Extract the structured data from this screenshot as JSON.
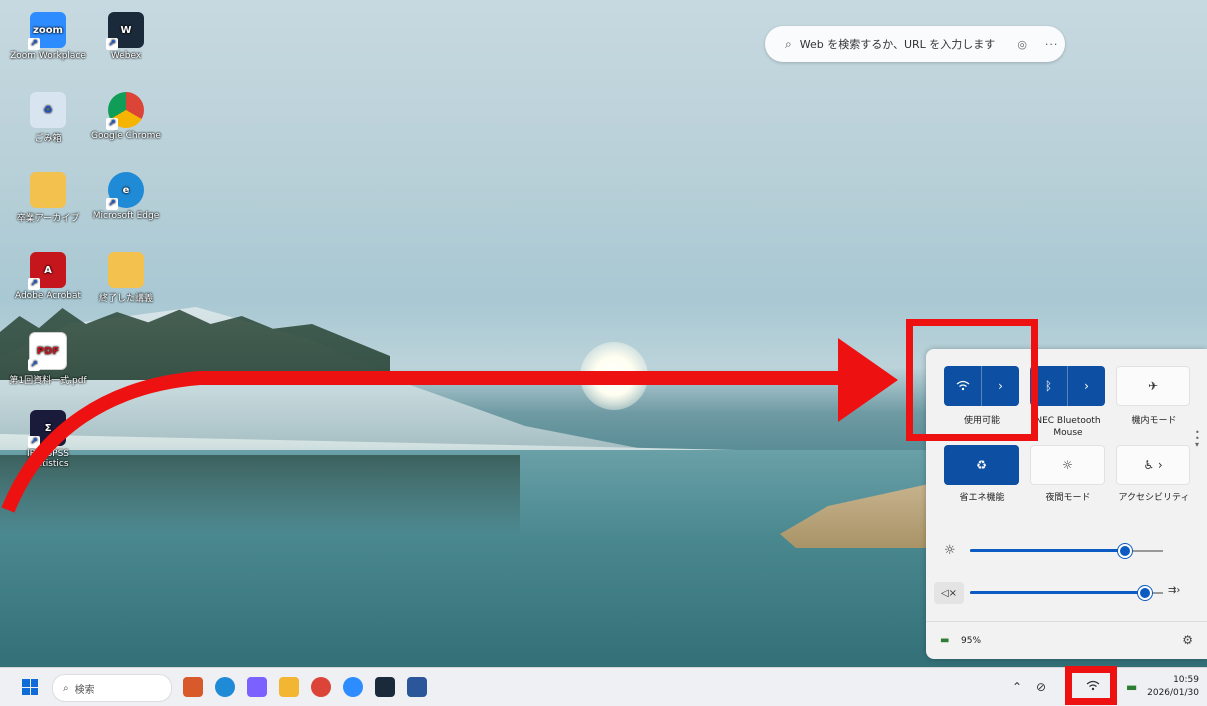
{
  "browser_search": {
    "placeholder": "Web を検索するか、URL を入力します",
    "search_icon": "search-icon",
    "visual_search_icon": "visual-search-icon",
    "more_label": "···"
  },
  "desktop_icons": [
    {
      "label": "Zoom Workplace",
      "icon": "zoom-icon",
      "text": "zoom",
      "color": "#2d8cff"
    },
    {
      "label": "Webex",
      "icon": "webex-icon",
      "text": "W",
      "color": "#1b2a3a"
    },
    {
      "label": "ごみ箱",
      "icon": "recycle-bin-icon",
      "text": "♻",
      "color": "#d8e4f0"
    },
    {
      "label": "Google Chrome",
      "icon": "chrome-icon",
      "text": "",
      "color": "#db4437"
    },
    {
      "label": "卒業アーカイブ",
      "icon": "folder-icon",
      "text": "",
      "color": "#f2c14e"
    },
    {
      "label": "Microsoft Edge",
      "icon": "edge-icon",
      "text": "e",
      "color": "#1f8ad6"
    },
    {
      "label": "Adobe Acrobat",
      "icon": "acrobat-icon",
      "text": "A",
      "color": "#c4161c"
    },
    {
      "label": "終了した講義",
      "icon": "folder-icon",
      "text": "",
      "color": "#f2c14e"
    },
    {
      "label": "第1回資料一式.pdf",
      "icon": "pdf-icon",
      "text": "PDF",
      "color": "#ffffff"
    },
    {
      "label": "IBM SPSS Statistics",
      "icon": "spss-icon",
      "text": "Σ",
      "color": "#1a1a3a"
    }
  ],
  "quick_settings": {
    "tiles": [
      {
        "label": "使用可能",
        "icon": "wifi-icon",
        "state": "on",
        "has_arrow": true
      },
      {
        "label": "NEC Bluetooth Mouse",
        "icon": "bluetooth-icon",
        "state": "on",
        "has_arrow": true
      },
      {
        "label": "機内モード",
        "icon": "airplane-icon",
        "state": "off",
        "has_arrow": false
      },
      {
        "label": "省エネ機能",
        "icon": "energy-saver-icon",
        "state": "on",
        "has_arrow": false
      },
      {
        "label": "夜間モード",
        "icon": "night-light-icon",
        "state": "off",
        "has_arrow": false
      },
      {
        "label": "アクセシビリティ",
        "icon": "accessibility-icon",
        "state": "off",
        "has_arrow": true
      }
    ],
    "brightness": {
      "icon": "brightness-icon",
      "level": 0.8
    },
    "volume": {
      "icon": "speaker-muted-icon",
      "level": 0.9,
      "output_icon": "audio-output-icon"
    },
    "battery_label": "95%",
    "settings_icon": "gear-icon"
  },
  "taskbar": {
    "search_placeholder": "検索",
    "apps": [
      {
        "name": "news-widget",
        "icon": "widget-icon",
        "color": "#d85a2a"
      },
      {
        "name": "edge",
        "icon": "edge-icon",
        "color": "#1f8ad6"
      },
      {
        "name": "copilot",
        "icon": "copilot-icon",
        "color": "#7b61ff"
      },
      {
        "name": "file-explorer",
        "icon": "folder-icon",
        "color": "#f2b632"
      },
      {
        "name": "chrome",
        "icon": "chrome-icon",
        "color": "#db4437"
      },
      {
        "name": "zoom",
        "icon": "zoom-icon",
        "color": "#2d8cff"
      },
      {
        "name": "webex",
        "icon": "webex-icon",
        "color": "#1b2a3a"
      },
      {
        "name": "word",
        "icon": "word-icon",
        "color": "#2b579a"
      }
    ],
    "tray_icons": [
      "chevron-up-icon",
      "mute-icon",
      "wifi-icon",
      "battery-icon"
    ],
    "time": "10:59",
    "date": "2026/01/30"
  },
  "annotation_color": "#ee1111"
}
